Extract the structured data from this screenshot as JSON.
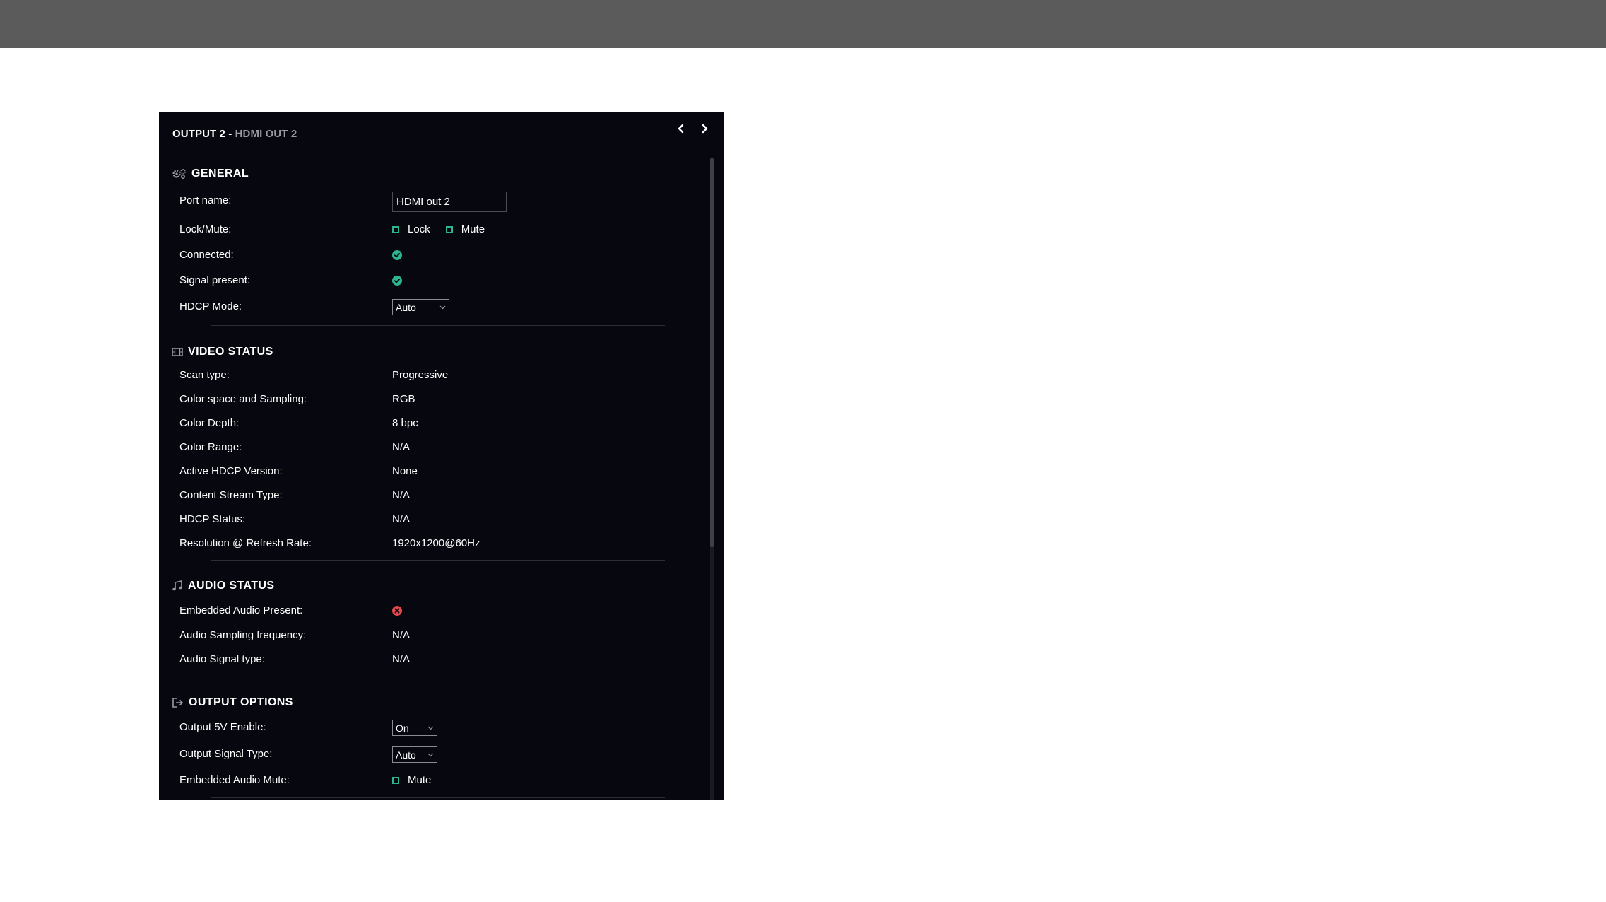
{
  "header": {
    "title_prefix": "OUTPUT 2 - ",
    "title_port": "HDMI OUT 2"
  },
  "nav": {
    "prev_icon": "chevron-left-icon",
    "next_icon": "chevron-right-icon"
  },
  "general": {
    "heading": "GENERAL",
    "port_name_label": "Port name:",
    "port_name_value": "HDMI out 2",
    "lock_mute_label": "Lock/Mute:",
    "lock_label": "Lock",
    "mute_label": "Mute",
    "connected_label": "Connected:",
    "connected_state": "ok",
    "signal_present_label": "Signal present:",
    "signal_present_state": "ok",
    "hdcp_mode_label": "HDCP Mode:",
    "hdcp_mode_value": "Auto"
  },
  "video_status": {
    "heading": "VIDEO STATUS",
    "scan_type_label": "Scan type:",
    "scan_type_value": "Progressive",
    "color_space_label": "Color space and Sampling:",
    "color_space_value": "RGB",
    "color_depth_label": "Color Depth:",
    "color_depth_value": "8 bpc",
    "color_range_label": "Color Range:",
    "color_range_value": "N/A",
    "active_hdcp_label": "Active HDCP Version:",
    "active_hdcp_value": "None",
    "content_stream_label": "Content Stream Type:",
    "content_stream_value": "N/A",
    "hdcp_status_label": "HDCP Status:",
    "hdcp_status_value": "N/A",
    "resolution_label": "Resolution @ Refresh Rate:",
    "resolution_value": "1920x1200@60Hz"
  },
  "audio_status": {
    "heading": "AUDIO STATUS",
    "embedded_audio_label": "Embedded Audio Present:",
    "embedded_audio_state": "error",
    "sampling_label": "Audio Sampling frequency:",
    "sampling_value": "N/A",
    "signal_type_label": "Audio Signal type:",
    "signal_type_value": "N/A"
  },
  "output_options": {
    "heading": "OUTPUT OPTIONS",
    "output_5v_label": "Output 5V Enable:",
    "output_5v_value": "On",
    "signal_type_label": "Output Signal Type:",
    "signal_type_value": "Auto",
    "embedded_mute_label": "Embedded Audio Mute:",
    "mute_label": "Mute"
  },
  "colors": {
    "panel_bg": "#07080f",
    "accent_green": "#2bb591",
    "error_red": "#e5484d",
    "muted_text": "#9a9aa2",
    "top_bar": "#5b5b5b"
  }
}
